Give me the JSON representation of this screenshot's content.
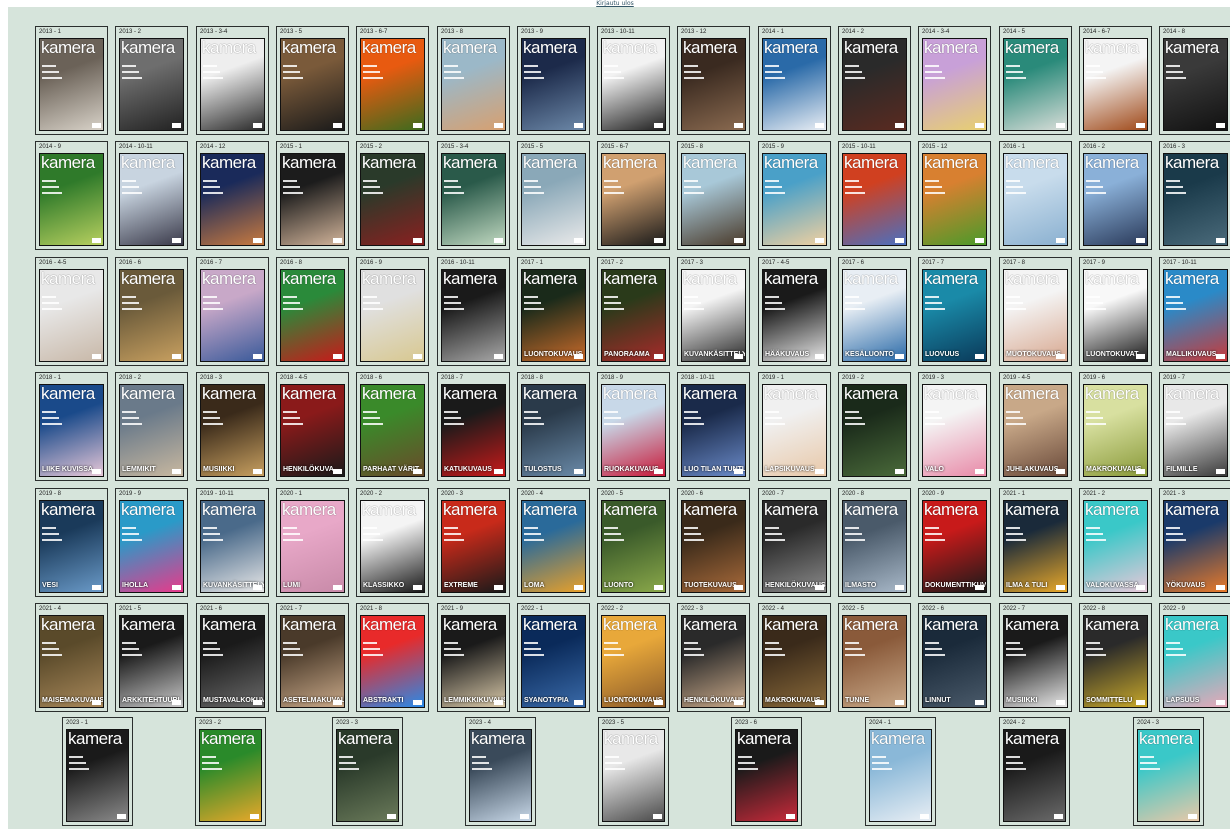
{
  "header": {
    "link_text": "Kirjautu ulos"
  },
  "issues": [
    {
      "label": "2013 - 1",
      "colors": [
        "#6b6258",
        "#d8d2c8"
      ],
      "theme": ""
    },
    {
      "label": "2013 - 2",
      "colors": [
        "#6e6e6e",
        "#222222"
      ],
      "theme": ""
    },
    {
      "label": "2013 - 3-4",
      "colors": [
        "#eeeeee",
        "#2a2a2a"
      ],
      "theme": ""
    },
    {
      "label": "2013 - 5",
      "colors": [
        "#7a5a3a",
        "#1a1a1a"
      ],
      "theme": ""
    },
    {
      "label": "2013 - 6-7",
      "colors": [
        "#e85a10",
        "#3c6b1e"
      ],
      "theme": ""
    },
    {
      "label": "2013 - 8",
      "colors": [
        "#9bb8c8",
        "#d7a070"
      ],
      "theme": ""
    },
    {
      "label": "2013 - 9",
      "colors": [
        "#1c2a4a",
        "#6c88a8"
      ],
      "theme": ""
    },
    {
      "label": "2013 - 10-11",
      "colors": [
        "#f2f2f2",
        "#202020"
      ],
      "theme": ""
    },
    {
      "label": "2013 - 12",
      "colors": [
        "#3a2a20",
        "#8a6a50"
      ],
      "theme": ""
    },
    {
      "label": "2014 - 1",
      "colors": [
        "#2a6aa8",
        "#e9eef4"
      ],
      "theme": ""
    },
    {
      "label": "2014 - 2",
      "colors": [
        "#2a2a2a",
        "#5a2a20"
      ],
      "theme": ""
    },
    {
      "label": "2014 - 3-4",
      "colors": [
        "#c8a0d8",
        "#e8d070"
      ],
      "theme": ""
    },
    {
      "label": "2014 - 5",
      "colors": [
        "#2a8a7a",
        "#d8ddd8"
      ],
      "theme": ""
    },
    {
      "label": "2014 - 6-7",
      "colors": [
        "#f4f4f4",
        "#a04a1a"
      ],
      "theme": ""
    },
    {
      "label": "2014 - 8",
      "colors": [
        "#3a3a3a",
        "#111111"
      ],
      "theme": ""
    },
    {
      "label": "2014 - 9",
      "colors": [
        "#2f7a2a",
        "#b8d060"
      ],
      "theme": ""
    },
    {
      "label": "2014 - 10-11",
      "colors": [
        "#c8d4e0",
        "#3a3a4a"
      ],
      "theme": ""
    },
    {
      "label": "2014 - 12",
      "colors": [
        "#1a2a5a",
        "#c87a40"
      ],
      "theme": ""
    },
    {
      "label": "2015 - 1",
      "colors": [
        "#1c1c1c",
        "#d2b49a"
      ],
      "theme": ""
    },
    {
      "label": "2015 - 2",
      "colors": [
        "#2a3a2a",
        "#8a2020"
      ],
      "theme": ""
    },
    {
      "label": "2015 - 3-4",
      "colors": [
        "#2a5a4a",
        "#c0d8c0"
      ],
      "theme": ""
    },
    {
      "label": "2015 - 5",
      "colors": [
        "#8aa8b8",
        "#eaeaea"
      ],
      "theme": ""
    },
    {
      "label": "2015 - 6-7",
      "colors": [
        "#d0a070",
        "#1a1a1a"
      ],
      "theme": ""
    },
    {
      "label": "2015 - 8",
      "colors": [
        "#a8c8d8",
        "#4a3a2a"
      ],
      "theme": ""
    },
    {
      "label": "2015 - 9",
      "colors": [
        "#4aa0c8",
        "#f0d0a0"
      ],
      "theme": ""
    },
    {
      "label": "2015 - 10-11",
      "colors": [
        "#d04020",
        "#4a70c0"
      ],
      "theme": ""
    },
    {
      "label": "2015 - 12",
      "colors": [
        "#d88030",
        "#4a9a2a"
      ],
      "theme": ""
    },
    {
      "label": "2016 - 1",
      "colors": [
        "#c8dcec",
        "#8ab0d0"
      ],
      "theme": ""
    },
    {
      "label": "2016 - 2",
      "colors": [
        "#8ab0d8",
        "#2a3a5a"
      ],
      "theme": ""
    },
    {
      "label": "2016 - 3",
      "colors": [
        "#1a3a4a",
        "#4a6a7a"
      ],
      "theme": ""
    },
    {
      "label": "2016 - 4-5",
      "colors": [
        "#e8e8e8",
        "#c8b8a8"
      ],
      "theme": ""
    },
    {
      "label": "2016 - 6",
      "colors": [
        "#6a5a3a",
        "#c8a060"
      ],
      "theme": ""
    },
    {
      "label": "2016 - 7",
      "colors": [
        "#c8a8c8",
        "#3a5a9a"
      ],
      "theme": ""
    },
    {
      "label": "2016 - 8",
      "colors": [
        "#2a8a3a",
        "#c81a1a"
      ],
      "theme": ""
    },
    {
      "label": "2016 - 9",
      "colors": [
        "#e0e0e0",
        "#d8c890"
      ],
      "theme": ""
    },
    {
      "label": "2016 - 10-11",
      "colors": [
        "#1a1a1a",
        "#a8a8a8"
      ],
      "theme": ""
    },
    {
      "label": "2017 - 1",
      "colors": [
        "#1a2a1a",
        "#c86a2a"
      ],
      "theme": "LUONTOKUVAUS"
    },
    {
      "label": "2017 - 2",
      "colors": [
        "#2a3a1a",
        "#a82a2a"
      ],
      "theme": "PANORAAMA"
    },
    {
      "label": "2017 - 3",
      "colors": [
        "#f4f4f4",
        "#2a2a2a"
      ],
      "theme": "KUVANKÄSITTELY"
    },
    {
      "label": "2017 - 4-5",
      "colors": [
        "#1a1a1a",
        "#e8e8e8"
      ],
      "theme": "HÄÄKUVAUS"
    },
    {
      "label": "2017 - 6",
      "colors": [
        "#e8eef4",
        "#2a6aa8"
      ],
      "theme": "KESÄLUONTO"
    },
    {
      "label": "2017 - 7",
      "colors": [
        "#1a8aa8",
        "#0a3a5a"
      ],
      "theme": "LUOVUUS"
    },
    {
      "label": "2017 - 8",
      "colors": [
        "#f4f4f4",
        "#d8a890"
      ],
      "theme": "MUOTOKUVAUS"
    },
    {
      "label": "2017 - 9",
      "colors": [
        "#f8f8f8",
        "#1a1a1a"
      ],
      "theme": "LUONTOKUVAT"
    },
    {
      "label": "2017 - 10-11",
      "colors": [
        "#2a8ac8",
        "#c83a3a"
      ],
      "theme": "MALLIKUVAUS"
    },
    {
      "label": "2018 - 1",
      "colors": [
        "#1a4a8a",
        "#e8c8d8"
      ],
      "theme": "LIIKE KUVISSA"
    },
    {
      "label": "2018 - 2",
      "colors": [
        "#6a7a8a",
        "#c8b8a0"
      ],
      "theme": "LEMMIKIT"
    },
    {
      "label": "2018 - 3",
      "colors": [
        "#3a2a1a",
        "#c8a060"
      ],
      "theme": "MUSIIKKI"
    },
    {
      "label": "2018 - 4-5",
      "colors": [
        "#8a1a1a",
        "#1a1a1a"
      ],
      "theme": "HENKILÖKUVA"
    },
    {
      "label": "2018 - 6",
      "colors": [
        "#3a8a2a",
        "#6a4a2a"
      ],
      "theme": "PARHAAT VÄRIT"
    },
    {
      "label": "2018 - 7",
      "colors": [
        "#1a1a1a",
        "#c81a1a"
      ],
      "theme": "KATUKUVAUS"
    },
    {
      "label": "2018 - 8",
      "colors": [
        "#2a3a4a",
        "#6a8aa8"
      ],
      "theme": "TULOSTUS"
    },
    {
      "label": "2018 - 9",
      "colors": [
        "#c8d8e8",
        "#c81a3a"
      ],
      "theme": "RUOKAKUVAUS"
    },
    {
      "label": "2018 - 10-11",
      "colors": [
        "#1a2a4a",
        "#6a8ac8"
      ],
      "theme": "LUO TILAN TUNTU"
    },
    {
      "label": "2019 - 1",
      "colors": [
        "#f0f0f0",
        "#e8c8a8"
      ],
      "theme": "LAPSIKUVAUS"
    },
    {
      "label": "2019 - 2",
      "colors": [
        "#1a2a1a",
        "#4a6a3a"
      ],
      "theme": ""
    },
    {
      "label": "2019 - 3",
      "colors": [
        "#f4f4f4",
        "#e88aa8"
      ],
      "theme": "VALO"
    },
    {
      "label": "2019 - 4-5",
      "colors": [
        "#c8a888",
        "#6a4a3a"
      ],
      "theme": "JUHLAKUVAUS"
    },
    {
      "label": "2019 - 6",
      "colors": [
        "#d8e0a0",
        "#8a9a3a"
      ],
      "theme": "MAKROKUVAUS"
    },
    {
      "label": "2019 - 7",
      "colors": [
        "#e8e8e8",
        "#3a3a3a"
      ],
      "theme": "FILMILLE"
    },
    {
      "label": "2019 - 8",
      "colors": [
        "#1a3a5a",
        "#6a9ac8"
      ],
      "theme": "VESI"
    },
    {
      "label": "2019 - 9",
      "colors": [
        "#2a9ac8",
        "#e83a8a"
      ],
      "theme": "IHOLLA"
    },
    {
      "label": "2019 - 10-11",
      "colors": [
        "#4a6a8a",
        "#e8e8e8"
      ],
      "theme": "KUVANKÄSITTELY"
    },
    {
      "label": "2020 - 1",
      "colors": [
        "#e8a8c8",
        "#c88aa8"
      ],
      "theme": "LUMI"
    },
    {
      "label": "2020 - 2",
      "colors": [
        "#f4f4f4",
        "#1a1a1a"
      ],
      "theme": "KLASSIKKO"
    },
    {
      "label": "2020 - 3",
      "colors": [
        "#c82a1a",
        "#1a1a1a"
      ],
      "theme": "EXTREME"
    },
    {
      "label": "2020 - 4",
      "colors": [
        "#2a6a9a",
        "#e8a02a"
      ],
      "theme": "LOMA"
    },
    {
      "label": "2020 - 5",
      "colors": [
        "#3a5a2a",
        "#8aa84a"
      ],
      "theme": "LUONTO"
    },
    {
      "label": "2020 - 6",
      "colors": [
        "#3a2a1a",
        "#a86a3a"
      ],
      "theme": "TUOTEKUVAUS"
    },
    {
      "label": "2020 - 7",
      "colors": [
        "#2a2a2a",
        "#8a8a8a"
      ],
      "theme": "HENKILÖKUVAUS"
    },
    {
      "label": "2020 - 8",
      "colors": [
        "#4a5a6a",
        "#a8b8c8"
      ],
      "theme": "ILMASTO"
    },
    {
      "label": "2020 - 9",
      "colors": [
        "#c81a1a",
        "#1a1a1a"
      ],
      "theme": "DOKUMENTTIKUVAUS"
    },
    {
      "label": "2021 - 1",
      "colors": [
        "#1a2a3a",
        "#e8a82a"
      ],
      "theme": "ILMA & TULI"
    },
    {
      "label": "2021 - 2",
      "colors": [
        "#3ac8c8",
        "#e8c8d8"
      ],
      "theme": "VALOKUVASSA"
    },
    {
      "label": "2021 - 3",
      "colors": [
        "#1a3a6a",
        "#e87a2a"
      ],
      "theme": "YÖKUVAUS"
    },
    {
      "label": "2021 - 4",
      "colors": [
        "#5a4a2a",
        "#a8885a"
      ],
      "theme": "MAISEMAKUVAUS"
    },
    {
      "label": "2021 - 5",
      "colors": [
        "#1a1a1a",
        "#c8c8c8"
      ],
      "theme": "ARKKITEHTUURI"
    },
    {
      "label": "2021 - 6",
      "colors": [
        "#1a1a1a",
        "#6a6a6a"
      ],
      "theme": "MUSTAVALKOKUVAUS"
    },
    {
      "label": "2021 - 7",
      "colors": [
        "#4a3a2a",
        "#c8a888"
      ],
      "theme": "ASETELMAKUVAUS"
    },
    {
      "label": "2021 - 8",
      "colors": [
        "#e82a2a",
        "#2a8ae8"
      ],
      "theme": "ABSTRAKTI"
    },
    {
      "label": "2021 - 9",
      "colors": [
        "#1a1a1a",
        "#d8c8a8"
      ],
      "theme": "LEMMIKKIKUVAUS"
    },
    {
      "label": "2022 - 1",
      "colors": [
        "#0a2a5a",
        "#3a6aa8"
      ],
      "theme": "SYANOTYPIA"
    },
    {
      "label": "2022 - 2",
      "colors": [
        "#e8a83a",
        "#8a5a2a"
      ],
      "theme": "LUONTOKUVAUS"
    },
    {
      "label": "2022 - 3",
      "colors": [
        "#2a2a2a",
        "#c8a888"
      ],
      "theme": "HENKILÖKUVAUS"
    },
    {
      "label": "2022 - 4",
      "colors": [
        "#3a2a1a",
        "#8a6a3a"
      ],
      "theme": "MAKROKUVAUS"
    },
    {
      "label": "2022 - 5",
      "colors": [
        "#8a5a3a",
        "#c8a888"
      ],
      "theme": "TUNNE"
    },
    {
      "label": "2022 - 6",
      "colors": [
        "#1a2a3a",
        "#4a5a6a"
      ],
      "theme": "LINNUT"
    },
    {
      "label": "2022 - 7",
      "colors": [
        "#1a1a1a",
        "#e8e8e8"
      ],
      "theme": "MUSIIKKI"
    },
    {
      "label": "2022 - 8",
      "colors": [
        "#2a2a2a",
        "#c8a82a"
      ],
      "theme": "SOMMITTELU"
    },
    {
      "label": "2022 - 9",
      "colors": [
        "#3ac8c8",
        "#e8a8b8"
      ],
      "theme": "LAPSUUS"
    }
  ],
  "issues_last_row": [
    {
      "label": "2023 - 1",
      "colors": [
        "#1a1a1a",
        "#8a8a8a"
      ]
    },
    {
      "label": "2023 - 2",
      "colors": [
        "#2a8a2a",
        "#e8a82a"
      ]
    },
    {
      "label": "2023 - 3",
      "colors": [
        "#2a3a2a",
        "#6a7a5a"
      ]
    },
    {
      "label": "2023 - 4",
      "colors": [
        "#3a4a5a",
        "#c8d8e8"
      ]
    },
    {
      "label": "2023 - 5",
      "colors": [
        "#e8e8e8",
        "#4a4a4a"
      ]
    },
    {
      "label": "2023 - 6",
      "colors": [
        "#1a1a1a",
        "#c82a3a"
      ]
    },
    {
      "label": "2024 - 1",
      "colors": [
        "#8ab8d8",
        "#e8eef4"
      ]
    },
    {
      "label": "2024 - 2",
      "colors": [
        "#1a1a1a",
        "#6a6a6a"
      ]
    },
    {
      "label": "2024 - 3",
      "colors": [
        "#3ac8c8",
        "#e8c8a8"
      ]
    }
  ],
  "masthead": "kamera"
}
